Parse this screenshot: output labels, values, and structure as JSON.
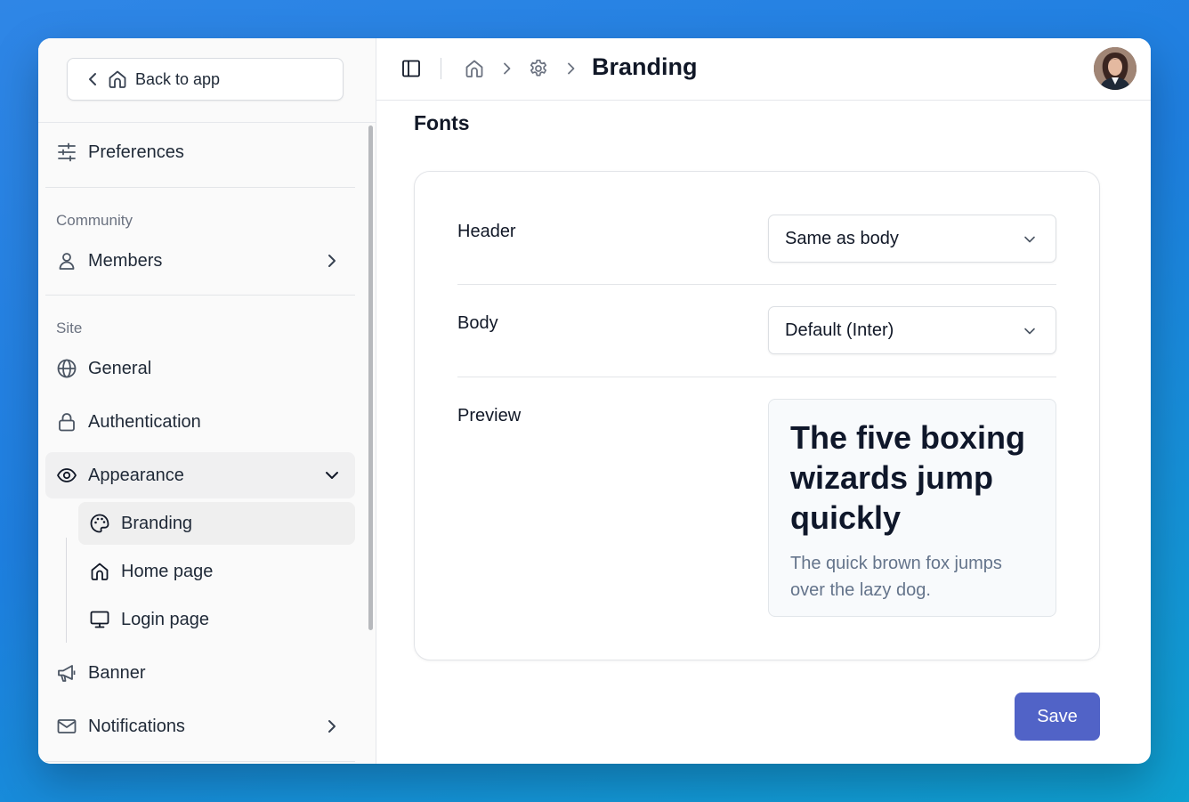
{
  "sidebar": {
    "back_label": "Back to app",
    "preferences": "Preferences",
    "sections": {
      "community": "Community",
      "site": "Site"
    },
    "members": "Members",
    "general": "General",
    "authentication": "Authentication",
    "appearance": "Appearance",
    "appearance_children": {
      "branding": "Branding",
      "home_page": "Home page",
      "login_page": "Login page"
    },
    "banner": "Banner",
    "notifications": "Notifications",
    "active_item": "Branding"
  },
  "header": {
    "title": "Branding",
    "breadcrumb_icons": [
      "home-icon",
      "gear-icon"
    ]
  },
  "main": {
    "section_title": "Fonts",
    "header_label": "Header",
    "header_value": "Same as body",
    "body_label": "Body",
    "body_value": "Default (Inter)",
    "preview_label": "Preview",
    "preview_heading": "The five boxing wizards jump quickly",
    "preview_text": "The quick brown fox jumps over the lazy dog.",
    "save_label": "Save"
  },
  "colors": {
    "accent": "#5163c7",
    "background_top": "#2f86e6",
    "background_bottom": "#0ea0d0"
  }
}
